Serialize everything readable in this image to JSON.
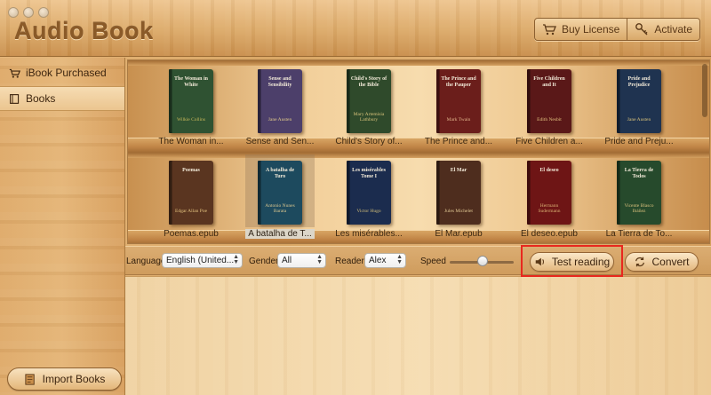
{
  "app": {
    "title": "Audio Book",
    "buy_license": "Buy License",
    "activate": "Activate"
  },
  "sidebar": {
    "items": [
      {
        "label": "iBook Purchased",
        "icon": "cart-icon"
      },
      {
        "label": "Books",
        "icon": "book-icon"
      }
    ],
    "import_label": "Import Books"
  },
  "shelf": {
    "rows": [
      [
        {
          "title": "The Woman in White",
          "author": "Wilkie Collins",
          "caption": "The Woman in...",
          "color": "#2f5232",
          "author_color": "#c9b85a"
        },
        {
          "title": "Sense and Sensibility",
          "author": "Jane Austen",
          "caption": "Sense and Sen...",
          "color": "#4c3f6a",
          "author_color": "#e0c98a"
        },
        {
          "title": "Child's Story of the Bible",
          "author": "Mary Artemisia Lathbury",
          "caption": "Child's Story of...",
          "color": "#2f4a2b",
          "author_color": "#d7c27a"
        },
        {
          "title": "The Prince and the Pauper",
          "author": "Mark Twain",
          "caption": "The Prince and...",
          "color": "#6b1e1b",
          "author_color": "#e0b48a"
        },
        {
          "title": "Five Children and It",
          "author": "Edith Nesbit",
          "caption": "Five Children a...",
          "color": "#5a1818",
          "author_color": "#e2c27e"
        },
        {
          "title": "Pride and Prejudice",
          "author": "Jane Austen",
          "caption": "Pride and Preju...",
          "color": "#1f3350",
          "author_color": "#d9c27a"
        }
      ],
      [
        {
          "title": "Poemas",
          "author": "Edgar Allan Poe",
          "caption": "Poemas.epub",
          "color": "#5a3520",
          "author_color": "#e2c27e"
        },
        {
          "title": "A batalha de Turo",
          "author": "Antonio Nunes Barata",
          "caption": "A batalha de T...",
          "color": "#1d4a5e",
          "author_color": "#d8c58e"
        },
        {
          "title": "Les misérables Tome I",
          "author": "Victor Hugo",
          "caption": "Les misérables...",
          "color": "#1b2c4e",
          "author_color": "#d2be78"
        },
        {
          "title": "El Mar",
          "author": "Jules Michelet",
          "caption": "El Mar.epub",
          "color": "#4e2d1e",
          "author_color": "#e2c994"
        },
        {
          "title": "El deseo",
          "author": "Hermann Sudermann",
          "caption": "El deseo.epub",
          "color": "#6e1515",
          "author_color": "#d8b172"
        },
        {
          "title": "La Tierra de Todos",
          "author": "Vicente Blasco Ibáñez",
          "caption": "La Tierra de To...",
          "color": "#264a2c",
          "author_color": "#d9c07c"
        }
      ]
    ]
  },
  "controls": {
    "language_label": "Language",
    "language_value": "English (United...",
    "gender_label": "Gender",
    "gender_value": "All",
    "reader_label": "Reader",
    "reader_value": "Alex",
    "speed_label": "Speed",
    "test_reading": "Test reading",
    "convert": "Convert"
  }
}
